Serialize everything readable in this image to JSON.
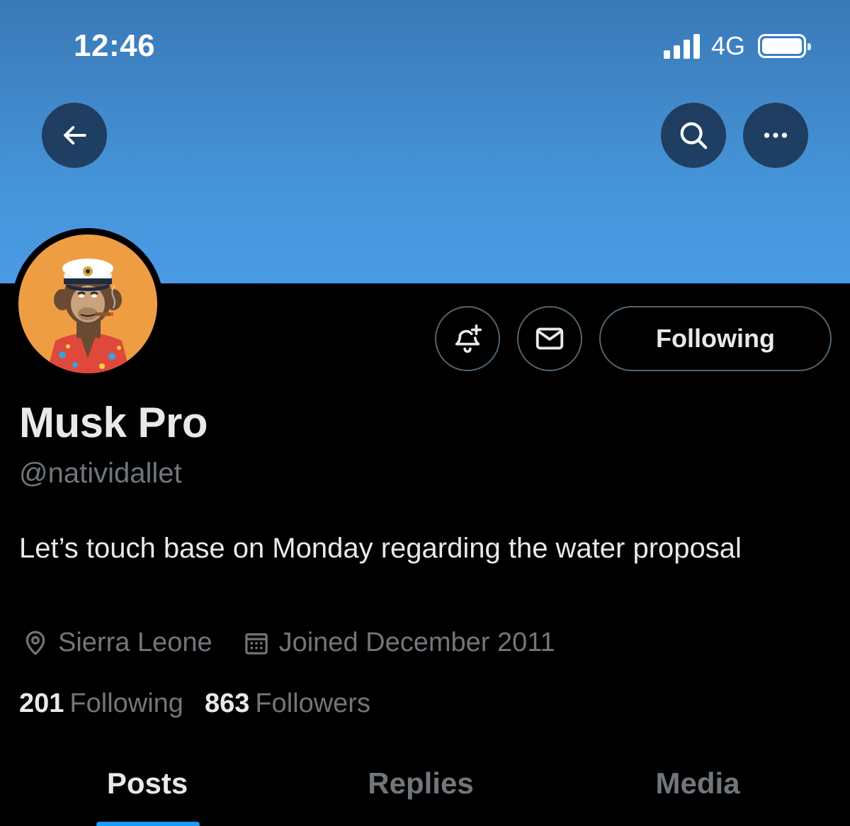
{
  "status_bar": {
    "time": "12:46",
    "network": "4G",
    "signal_bars": 4,
    "battery_level": 1.0
  },
  "header": {
    "back_icon": "arrow-left-icon",
    "search_icon": "search-icon",
    "more_icon": "more-horizontal-icon",
    "banner_color": "#4594d9"
  },
  "profile": {
    "avatar_icon": "ape-avatar-with-captain-hat",
    "display_name": "Musk Pro",
    "handle": "@nativi­dallet",
    "bio": "Let’s touch base on Monday regarding the water proposal",
    "location": "Sierra Leone",
    "joined": "Joined December 2011",
    "following_count": "201",
    "following_label": "Following",
    "followers_count": "863",
    "followers_label": "Followers"
  },
  "actions": {
    "notify_icon": "bell-plus-icon",
    "message_icon": "envelope-icon",
    "follow_button_label": "Following"
  },
  "tabs": [
    {
      "label": "Posts",
      "active": true
    },
    {
      "label": "Replies",
      "active": false
    },
    {
      "label": "Media",
      "active": false
    }
  ],
  "colors": {
    "accent": "#1d9bf0",
    "secondary_text": "#71767b",
    "primary_text": "#e7e9ea"
  }
}
